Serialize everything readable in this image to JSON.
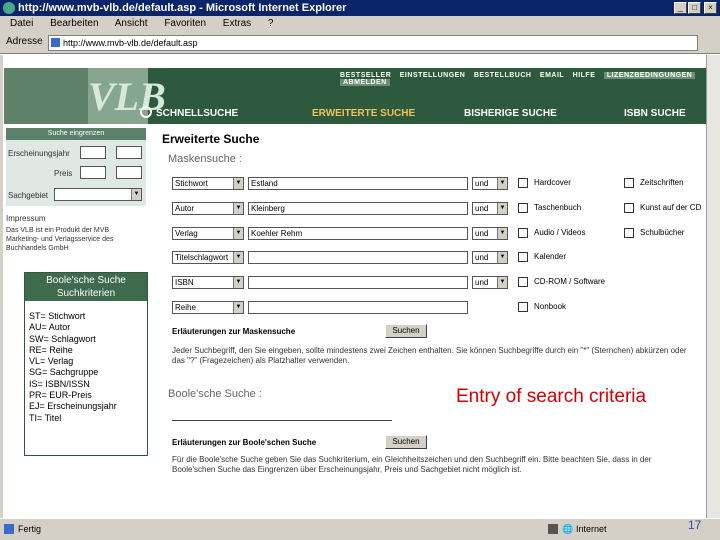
{
  "window": {
    "title": "http://www.mvb-vlb.de/default.asp - Microsoft Internet Explorer"
  },
  "menu": [
    "Datei",
    "Bearbeiten",
    "Ansicht",
    "Favoriten",
    "Extras",
    "?"
  ],
  "address": {
    "label": "Adresse",
    "url": "http://www.mvb-vlb.de/default.asp"
  },
  "nav": {
    "links": [
      "BESTSELLER",
      "EINSTELLUNGEN",
      "BESTELLBUCH",
      "EMAIL",
      "HILFE",
      "LIZENZBEDINGUNGEN",
      "ABMELDEN"
    ],
    "logo": "VLB",
    "tabs": [
      "SCHNELLSUCHE",
      "ERWEITERTE SUCHE",
      "BISHERIGE SUCHE",
      "ISBN SUCHE"
    ]
  },
  "left": {
    "title": "Suche eingrenzen",
    "fields": [
      "Erscheinungsjahr",
      "Preis",
      "Sachgebiet"
    ],
    "imprint": "Impressum",
    "about": "Das VLB ist ein Produkt der MVB Marketing- und Verlagsservice des Buchhandels GmbH"
  },
  "main": {
    "heading": "Erweiterte Suche",
    "mask_label": "Maskensuche :",
    "rows": [
      {
        "field": "Stichwort",
        "value": "Estland",
        "op": "und"
      },
      {
        "field": "Autor",
        "value": "Kleinberg",
        "op": "und"
      },
      {
        "field": "Verlag",
        "value": "Koehler Rehm",
        "op": "und"
      },
      {
        "field": "Titelschlagwort",
        "value": "",
        "op": "und"
      },
      {
        "field": "ISBN",
        "value": "",
        "op": "und"
      },
      {
        "field": "Reihe",
        "value": "",
        "op": ""
      }
    ],
    "checks_left": [
      "Hardcover",
      "Taschenbuch",
      "Audio / Videos",
      "Kalender",
      "CD-ROM / Software",
      "Nonbook"
    ],
    "checks_right": [
      "Zeitschriften",
      "Kunst auf der CD",
      "Schulbücher"
    ],
    "mask_explain": "Erläuterungen zur Maskensuche",
    "search_btn": "Suchen",
    "mask_note": "Jeder Suchbegriff, den Sie eingeben, sollte mindestens zwei Zeichen enthalten. Sie können Suchbegriffe durch ein \"*\" (Sternchen) abkürzen oder das \"?\" (Fragezeichen) als Platzhalter verwenden.",
    "bool_label": "Boole'sche Suche :",
    "bool_explain": "Erläuterungen zur Boole'schen Suche",
    "bool_note": "Für die Boole'sche Suche geben Sie das Suchkriterium, ein Gleichheitszeichen und den Suchbegriff ein. Bitte beachten Sie, dass in der Boole'schen Suche das Eingrenzen über Erscheinungsjahr, Preis und Sachgebiet nicht möglich ist."
  },
  "bool_box": {
    "title1": "Boole'sche Suche",
    "title2": "Suchkriterien",
    "items": [
      "ST= Stichwort",
      "AU= Autor",
      "SW= Schlagwort",
      "RE= Reihe",
      "VL= Verlag",
      "SG= Sachgruppe",
      "IS= ISBN/ISSN",
      "PR= EUR-Preis",
      "EJ= Erscheinungsjahr",
      "TI= Titel"
    ]
  },
  "status": {
    "left": "Fertig",
    "right": "Internet"
  },
  "caption": "Entry of search criteria",
  "page_number": "17"
}
